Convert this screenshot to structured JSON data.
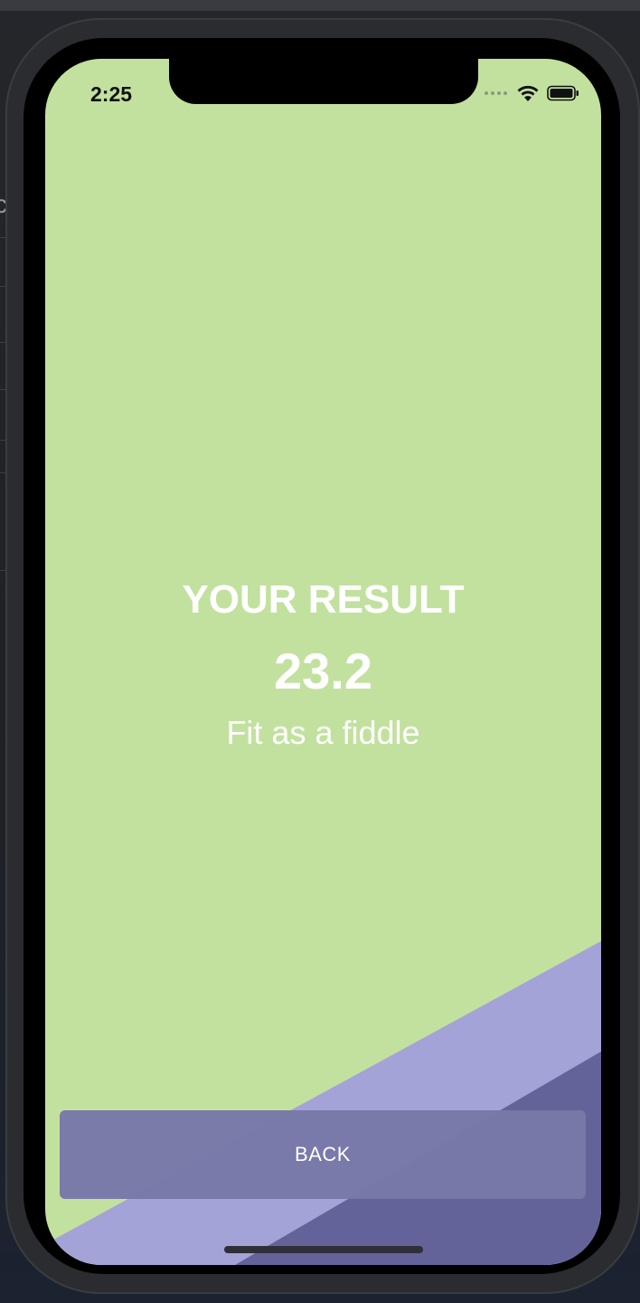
{
  "status_bar": {
    "time": "2:25"
  },
  "result": {
    "title": "YOUR RESULT",
    "value": "23.2",
    "message": "Fit as a fiddle"
  },
  "actions": {
    "back_label": "BACK"
  },
  "colors": {
    "background": "#c2e19f",
    "stripe_light": "#a3a3d8",
    "stripe_dark": "#646399",
    "button": "#7878a8",
    "text": "#ffffff"
  },
  "icons": [
    "cellular-signal-icon",
    "wifi-icon",
    "battery-icon"
  ]
}
